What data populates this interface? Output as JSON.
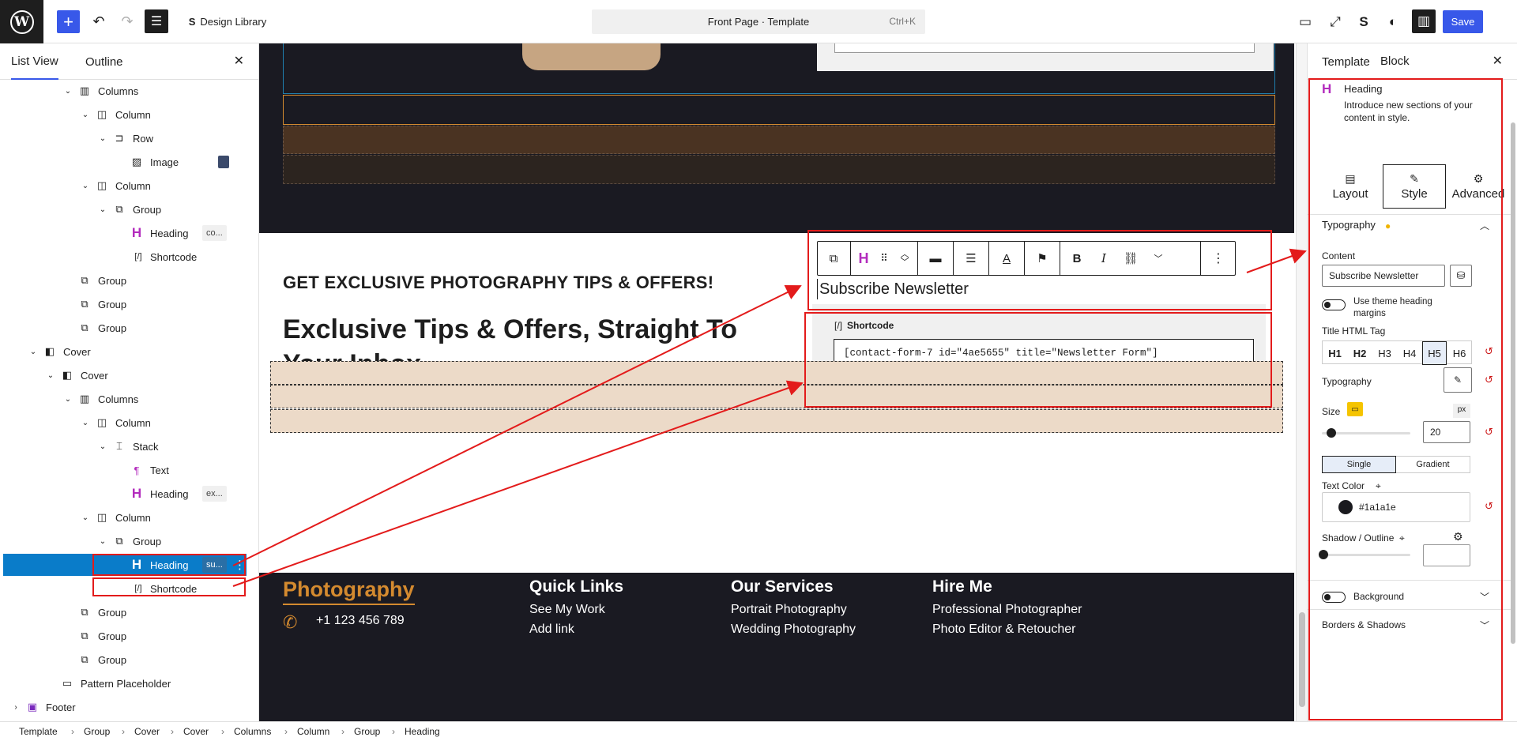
{
  "topbar": {
    "design_library": "Design Library",
    "command_title": "Front Page · Template",
    "command_shortcut": "Ctrl+K",
    "save_label": "Save"
  },
  "left_panel": {
    "tabs": [
      "List View",
      "Outline"
    ],
    "tree": [
      {
        "label": "Columns",
        "icon": "columns-icon",
        "depth": 3,
        "chev": true
      },
      {
        "label": "Column",
        "icon": "column-icon",
        "depth": 4,
        "chev": true
      },
      {
        "label": "Row",
        "icon": "row-icon",
        "depth": 5,
        "chev": true
      },
      {
        "label": "Image",
        "icon": "image-icon",
        "depth": 6,
        "chev": false,
        "thumb": true
      },
      {
        "label": "Column",
        "icon": "column-icon",
        "depth": 4,
        "chev": true
      },
      {
        "label": "Group",
        "icon": "group-icon",
        "depth": 5,
        "chev": true
      },
      {
        "label": "Heading",
        "icon": "heading-icon",
        "depth": 6,
        "chev": false,
        "badge": "co..."
      },
      {
        "label": "Shortcode",
        "icon": "shortcode-icon",
        "depth": 6,
        "chev": false
      },
      {
        "label": "Group",
        "icon": "group-icon",
        "depth": 3,
        "chev": false
      },
      {
        "label": "Group",
        "icon": "group-icon",
        "depth": 3,
        "chev": false
      },
      {
        "label": "Group",
        "icon": "group-icon",
        "depth": 3,
        "chev": false
      },
      {
        "label": "Cover",
        "icon": "cover-icon",
        "depth": 1,
        "chev": true
      },
      {
        "label": "Cover",
        "icon": "cover-icon",
        "depth": 2,
        "chev": true
      },
      {
        "label": "Columns",
        "icon": "columns-icon",
        "depth": 3,
        "chev": true
      },
      {
        "label": "Column",
        "icon": "column-icon",
        "depth": 4,
        "chev": true
      },
      {
        "label": "Stack",
        "icon": "stack-icon",
        "depth": 5,
        "chev": true
      },
      {
        "label": "Text",
        "icon": "paragraph-icon",
        "depth": 6,
        "chev": false
      },
      {
        "label": "Heading",
        "icon": "heading-icon",
        "depth": 6,
        "chev": false,
        "badge": "ex..."
      },
      {
        "label": "Column",
        "icon": "column-icon",
        "depth": 4,
        "chev": true
      },
      {
        "label": "Group",
        "icon": "group-icon",
        "depth": 5,
        "chev": true
      },
      {
        "label": "Heading",
        "icon": "heading-icon",
        "depth": 6,
        "chev": false,
        "badge": "su...",
        "selected": true
      },
      {
        "label": "Shortcode",
        "icon": "shortcode-icon",
        "depth": 6,
        "chev": false
      },
      {
        "label": "Group",
        "icon": "group-icon",
        "depth": 3,
        "chev": false
      },
      {
        "label": "Group",
        "icon": "group-icon",
        "depth": 3,
        "chev": false
      },
      {
        "label": "Group",
        "icon": "group-icon",
        "depth": 3,
        "chev": false
      },
      {
        "label": "Pattern Placeholder",
        "icon": "pattern-icon",
        "depth": 2,
        "chev": false
      },
      {
        "label": "Footer",
        "icon": "footer-icon",
        "depth": 0,
        "chev": true,
        "collapsed": true
      }
    ]
  },
  "canvas": {
    "kicker": "GET EXCLUSIVE PHOTOGRAPHY TIPS & OFFERS!",
    "big_heading": "Exclusive Tips & Offers, Straight To Your Inbox",
    "subscribe_heading": "Subscribe Newsletter",
    "shortcode_label": "Shortcode",
    "shortcode_value": "[contact-form-7 id=\"4ae5655\" title=\"Newsletter Form\"]",
    "footer": {
      "logo": "Photography",
      "phone": "+1 123 456 789",
      "add_link": "Add link",
      "columns": [
        {
          "title": "Quick Links",
          "links": [
            "See My Work"
          ]
        },
        {
          "title": "Our Services",
          "links": [
            "Portrait Photography",
            "Wedding Photography"
          ]
        },
        {
          "title": "Hire Me",
          "links": [
            "Professional Photographer",
            "Photo Editor & Retoucher"
          ]
        }
      ]
    }
  },
  "right_panel": {
    "tabs": [
      "Template",
      "Block"
    ],
    "block_name": "Heading",
    "block_desc": "Introduce new sections of your content in style.",
    "subtabs": [
      "Layout",
      "Style",
      "Advanced"
    ],
    "typography_section": "Typography",
    "content_label": "Content",
    "content_value": "Subscribe Newsletter",
    "theme_margins_label": "Use theme heading margins",
    "title_tag_label": "Title HTML Tag",
    "tags": [
      "H1",
      "H2",
      "H3",
      "H4",
      "H5",
      "H6"
    ],
    "active_tag": "H5",
    "typography_label": "Typography",
    "size_label": "Size",
    "size_unit": "px",
    "size_value": "20",
    "color_modes": [
      "Single",
      "Gradient"
    ],
    "text_color_label": "Text Color",
    "text_color_value": "#1a1a1e",
    "shadow_label": "Shadow / Outline",
    "background_label": "Background",
    "borders_label": "Borders & Shadows"
  },
  "breadcrumb": [
    "Template",
    "Group",
    "Cover",
    "Cover",
    "Columns",
    "Column",
    "Group",
    "Heading"
  ],
  "colors": {
    "accent": "#3858e9",
    "selected": "#0a7cc9",
    "annotation": "#e31b1b",
    "footer_brand": "#d48a2f"
  }
}
